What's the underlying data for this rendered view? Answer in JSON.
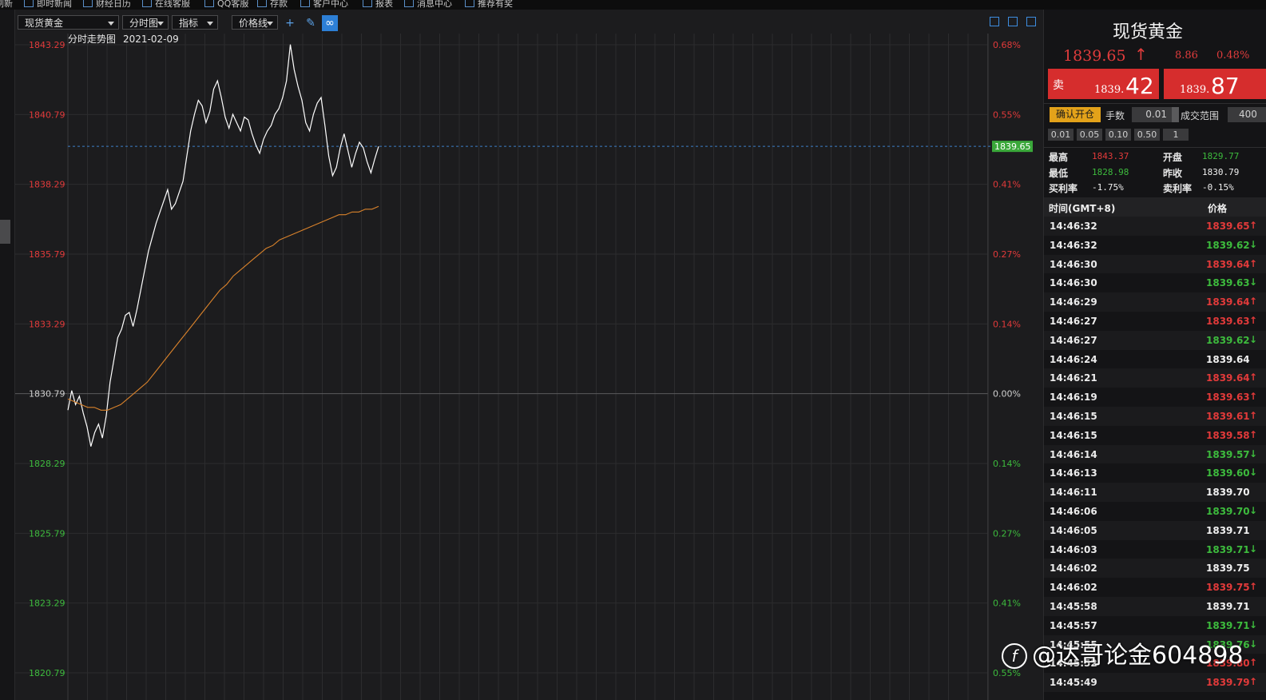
{
  "menubar": {
    "items": [
      {
        "label": "刷新",
        "icon": "refresh-icon"
      },
      {
        "label": "即时新闻",
        "icon": "news-icon"
      },
      {
        "label": "财经日历",
        "icon": "calendar-icon"
      },
      {
        "label": "在线客服",
        "icon": "support-icon"
      },
      {
        "label": "QQ客服",
        "icon": "qq-icon"
      },
      {
        "label": "存款",
        "icon": "deposit-icon"
      },
      {
        "label": "客户中心",
        "icon": "globe-icon"
      },
      {
        "label": "报表",
        "icon": "report-icon"
      },
      {
        "label": "消息中心",
        "icon": "message-icon"
      },
      {
        "label": "推荐有奖",
        "icon": "share-icon"
      }
    ]
  },
  "toolbar": {
    "symbol": "现货黄金",
    "period": "分时图",
    "indicator": "指标",
    "line_mode": "价格线"
  },
  "chart_header": {
    "title": "分时走势图",
    "date": "2021-02-09"
  },
  "chart_data": {
    "type": "line",
    "title": "分时走势图",
    "date": "2021-02-09",
    "y_ticks_left": [
      "1843.29",
      "1840.79",
      "1838.29",
      "1835.79",
      "1833.29",
      "1830.79",
      "1828.29",
      "1825.79",
      "1823.29",
      "1820.79"
    ],
    "y_ticks_right": [
      "0.68%",
      "0.55%",
      "0.41%",
      "0.27%",
      "0.14%",
      "0.00%",
      "0.14%",
      "0.27%",
      "0.41%",
      "0.55%"
    ],
    "ylim": [
      1820.79,
      1843.29
    ],
    "base_price": 1830.79,
    "current_price": "1839.65",
    "colors": {
      "up": "#e23a3a",
      "down": "#3dbb3d",
      "price_line": "#ffffff",
      "avg_line": "#d9822b",
      "current_tag": "#3aa83a"
    },
    "series": [
      {
        "values": [
          1830.2,
          1830.9,
          1830.4,
          1830.7,
          1830.1,
          1829.6,
          1828.9,
          1829.4,
          1829.7,
          1829.2,
          1830.0,
          1831.2,
          1832.0,
          1832.8,
          1833.1,
          1833.6,
          1833.7,
          1833.2,
          1833.8,
          1834.5,
          1835.2,
          1835.9,
          1836.4,
          1836.9,
          1837.3,
          1837.7,
          1838.1,
          1837.4,
          1837.6,
          1838.0,
          1838.4,
          1839.3,
          1840.2,
          1840.8,
          1841.3,
          1841.1,
          1840.5,
          1840.9,
          1841.7,
          1842.0,
          1841.4,
          1840.7,
          1840.3,
          1840.8,
          1840.5,
          1840.2,
          1840.7,
          1840.6,
          1840.1,
          1839.7,
          1839.4,
          1839.9,
          1840.2,
          1840.4,
          1840.8,
          1841.0,
          1841.4,
          1842.0,
          1843.3,
          1842.4,
          1841.8,
          1841.3,
          1840.5,
          1840.2,
          1840.8,
          1841.2,
          1841.4,
          1840.4,
          1839.3,
          1838.6,
          1838.9,
          1839.6,
          1840.1,
          1839.5,
          1838.9,
          1839.4,
          1839.8,
          1839.6,
          1839.1,
          1838.7,
          1839.2,
          1839.65
        ]
      },
      {
        "values": [
          1830.6,
          1830.5,
          1830.4,
          1830.3,
          1830.3,
          1830.2,
          1830.2,
          1830.3,
          1830.4,
          1830.6,
          1830.8,
          1831.0,
          1831.2,
          1831.5,
          1831.8,
          1832.1,
          1832.4,
          1832.7,
          1833.0,
          1833.3,
          1833.6,
          1833.9,
          1834.2,
          1834.5,
          1834.7,
          1835.0,
          1835.2,
          1835.4,
          1835.6,
          1835.8,
          1836.0,
          1836.1,
          1836.3,
          1836.4,
          1836.5,
          1836.6,
          1836.7,
          1836.8,
          1836.9,
          1837.0,
          1837.1,
          1837.2,
          1837.2,
          1837.3,
          1837.3,
          1837.4,
          1837.4,
          1837.5
        ]
      }
    ]
  },
  "quote": {
    "title": "现货黄金",
    "price": "1839.65",
    "change": "8.86",
    "change_pct": "0.48%",
    "sell_label": "卖",
    "sell_small": "1839.",
    "sell_big": "42",
    "buy_small": "1839.",
    "buy_big": "87"
  },
  "order": {
    "open_button": "确认开仓",
    "lots_label": "手数",
    "lots_value": "0.01",
    "range_label": "成交范围",
    "range_value": "400",
    "quick_lots": [
      "0.01",
      "0.05",
      "0.10",
      "0.50",
      "1"
    ]
  },
  "stats": {
    "high_label": "最高",
    "high_value": "1843.37",
    "open_label": "开盘",
    "open_value": "1829.77",
    "low_label": "最低",
    "low_value": "1828.98",
    "prev_close_label": "昨收",
    "prev_close_value": "1830.79",
    "buy_rate_label": "买利率",
    "buy_rate_value": "-1.75%",
    "sell_rate_label": "卖利率",
    "sell_rate_value": "-0.15%"
  },
  "ticks": {
    "header_time": "时间(GMT+8)",
    "header_price": "价格",
    "rows": [
      {
        "time": "14:46:32",
        "price": "1839.65",
        "dir": "up"
      },
      {
        "time": "14:46:32",
        "price": "1839.62",
        "dir": "down"
      },
      {
        "time": "14:46:30",
        "price": "1839.64",
        "dir": "up"
      },
      {
        "time": "14:46:30",
        "price": "1839.63",
        "dir": "down"
      },
      {
        "time": "14:46:29",
        "price": "1839.64",
        "dir": "up"
      },
      {
        "time": "14:46:27",
        "price": "1839.63",
        "dir": "up"
      },
      {
        "time": "14:46:27",
        "price": "1839.62",
        "dir": "down"
      },
      {
        "time": "14:46:24",
        "price": "1839.64",
        "dir": "flat"
      },
      {
        "time": "14:46:21",
        "price": "1839.64",
        "dir": "up"
      },
      {
        "time": "14:46:19",
        "price": "1839.63",
        "dir": "up"
      },
      {
        "time": "14:46:15",
        "price": "1839.61",
        "dir": "up"
      },
      {
        "time": "14:46:15",
        "price": "1839.58",
        "dir": "up"
      },
      {
        "time": "14:46:14",
        "price": "1839.57",
        "dir": "down"
      },
      {
        "time": "14:46:13",
        "price": "1839.60",
        "dir": "down"
      },
      {
        "time": "14:46:11",
        "price": "1839.70",
        "dir": "flat"
      },
      {
        "time": "14:46:06",
        "price": "1839.70",
        "dir": "down"
      },
      {
        "time": "14:46:05",
        "price": "1839.71",
        "dir": "flat"
      },
      {
        "time": "14:46:03",
        "price": "1839.71",
        "dir": "down"
      },
      {
        "time": "14:46:02",
        "price": "1839.75",
        "dir": "flat"
      },
      {
        "time": "14:46:02",
        "price": "1839.75",
        "dir": "up"
      },
      {
        "time": "14:45:58",
        "price": "1839.71",
        "dir": "flat"
      },
      {
        "time": "14:45:57",
        "price": "1839.71",
        "dir": "down"
      },
      {
        "time": "14:45:55",
        "price": "1839.76",
        "dir": "down"
      },
      {
        "time": "14:45:52",
        "price": "1839.80",
        "dir": "up"
      },
      {
        "time": "14:45:49",
        "price": "1839.79",
        "dir": "up"
      }
    ]
  },
  "watermark": "@达哥论金604898"
}
